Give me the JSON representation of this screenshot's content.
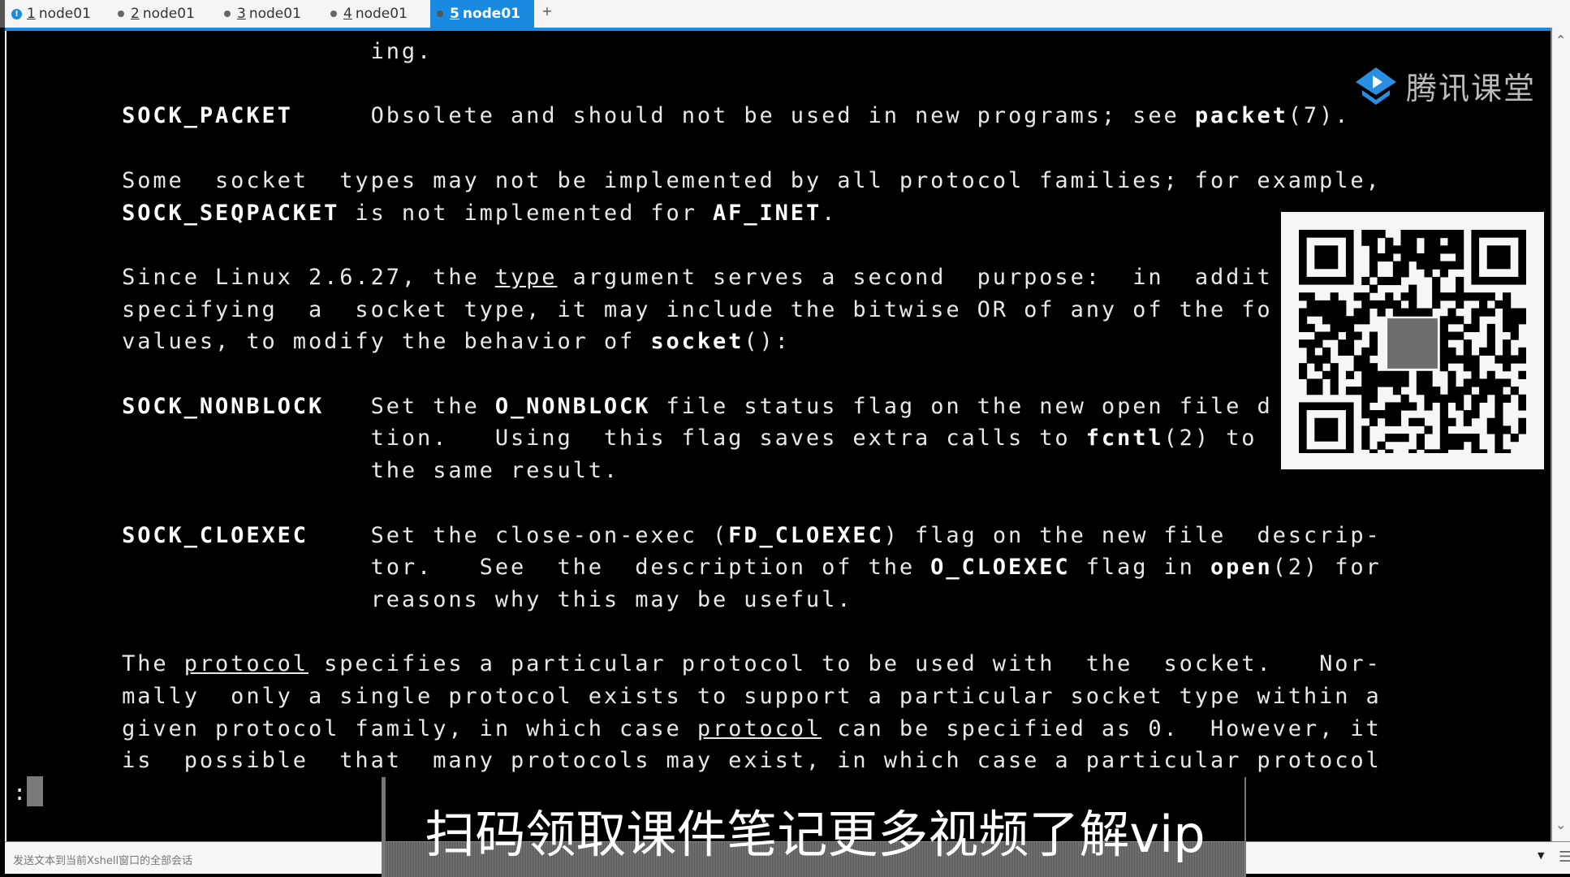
{
  "tabs": [
    {
      "num": "1",
      "label": "node01",
      "indicator": "alert",
      "active": false
    },
    {
      "num": "2",
      "label": "node01",
      "indicator": "dot",
      "active": false
    },
    {
      "num": "3",
      "label": "node01",
      "indicator": "dot",
      "active": false
    },
    {
      "num": "4",
      "label": "node01",
      "indicator": "dot",
      "active": false
    },
    {
      "num": "5",
      "label": "node01",
      "indicator": "dot",
      "active": true
    }
  ],
  "add_tab_label": "+",
  "accent_color": "#1a8ae0",
  "terminal": {
    "lines": [
      {
        "row": 0,
        "segs": [
          [
            "                       ing.",
            ""
          ]
        ]
      },
      {
        "row": 2,
        "segs": [
          [
            "       ",
            ""
          ],
          [
            "SOCK_PACKET",
            "b"
          ],
          [
            "     Obsolete and should not be used in new programs; see ",
            ""
          ],
          [
            "packet",
            "b"
          ],
          [
            "(7).",
            ""
          ]
        ]
      },
      {
        "row": 4,
        "segs": [
          [
            "       Some  socket  types may not be implemented by all protocol families; for example,",
            ""
          ]
        ]
      },
      {
        "row": 5,
        "segs": [
          [
            "       ",
            ""
          ],
          [
            "SOCK_SEQPACKET",
            "b"
          ],
          [
            " is not implemented for ",
            ""
          ],
          [
            "AF_INET",
            "b"
          ],
          [
            ".",
            ""
          ]
        ]
      },
      {
        "row": 7,
        "segs": [
          [
            "       Since Linux 2.6.27, the ",
            ""
          ],
          [
            "type",
            "u"
          ],
          [
            " argument serves a second  purpose:  in  addit",
            ""
          ]
        ]
      },
      {
        "row": 8,
        "segs": [
          [
            "       specifying  a  socket type, it may include the bitwise OR of any of the fo",
            ""
          ]
        ]
      },
      {
        "row": 9,
        "segs": [
          [
            "       values, to modify the behavior of ",
            ""
          ],
          [
            "socket",
            "b"
          ],
          [
            "():",
            ""
          ]
        ]
      },
      {
        "row": 11,
        "segs": [
          [
            "       ",
            ""
          ],
          [
            "SOCK_NONBLOCK",
            "b"
          ],
          [
            "   Set the ",
            ""
          ],
          [
            "O_NONBLOCK",
            "b"
          ],
          [
            " file status flag on the new open file d",
            ""
          ]
        ]
      },
      {
        "row": 12,
        "segs": [
          [
            "                       tion.   Using  this flag saves extra calls to ",
            ""
          ],
          [
            "fcntl",
            "b"
          ],
          [
            "(2) to",
            ""
          ]
        ]
      },
      {
        "row": 13,
        "segs": [
          [
            "                       the same result.",
            ""
          ]
        ]
      },
      {
        "row": 15,
        "segs": [
          [
            "       ",
            ""
          ],
          [
            "SOCK_CLOEXEC",
            "b"
          ],
          [
            "    Set the close-on-exec (",
            ""
          ],
          [
            "FD_CLOEXEC",
            "b"
          ],
          [
            ") flag on the new file  descrip-",
            ""
          ]
        ]
      },
      {
        "row": 16,
        "segs": [
          [
            "                       tor.   See  the  description of the ",
            ""
          ],
          [
            "O_CLOEXEC",
            "b"
          ],
          [
            " flag in ",
            ""
          ],
          [
            "open",
            "b"
          ],
          [
            "(2) for",
            ""
          ]
        ]
      },
      {
        "row": 17,
        "segs": [
          [
            "                       reasons why this may be useful.",
            ""
          ]
        ]
      },
      {
        "row": 19,
        "segs": [
          [
            "       The ",
            ""
          ],
          [
            "protocol",
            "u"
          ],
          [
            " specifies a particular protocol to be used with  the  socket.   Nor-",
            ""
          ]
        ]
      },
      {
        "row": 20,
        "segs": [
          [
            "       mally  only a single protocol exists to support a particular socket type within a",
            ""
          ]
        ]
      },
      {
        "row": 21,
        "segs": [
          [
            "       given protocol family, in which case ",
            ""
          ],
          [
            "protocol",
            "u"
          ],
          [
            " can be specified as 0.  However, it",
            ""
          ]
        ]
      },
      {
        "row": 22,
        "segs": [
          [
            "       is  possible  that  many protocols may exist, in which case a particular protocol",
            ""
          ]
        ]
      },
      {
        "row": 23,
        "segs": [
          [
            ":",
            ""
          ]
        ]
      }
    ]
  },
  "watermark": {
    "logo_text": "腾讯课堂"
  },
  "caption": "扫码领取课件笔记更多视频了解vip",
  "status_bar": {
    "text": "发送文本到当前Xshell窗口的全部会话"
  },
  "icons": {
    "scroll_up": "chevron-up-icon",
    "scroll_down": "chevron-down-icon",
    "menu": "menu-icon",
    "dropdown": "caret-down-icon"
  }
}
